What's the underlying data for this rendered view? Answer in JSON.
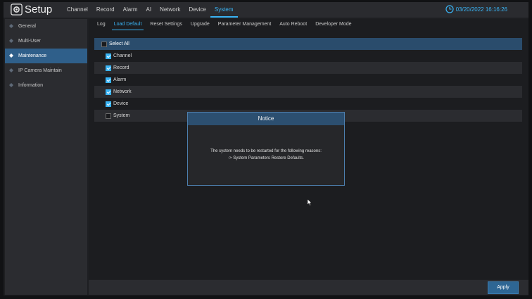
{
  "topbar": {
    "title": "Setup",
    "nav": [
      "Channel",
      "Record",
      "Alarm",
      "AI",
      "Network",
      "Device",
      "System"
    ],
    "active_nav": "System",
    "datetime": "03/20/2022 16:16:26"
  },
  "sidebar": {
    "items": [
      {
        "label": "General"
      },
      {
        "label": "Multi-User"
      },
      {
        "label": "Maintenance",
        "active": true
      },
      {
        "label": "IP Camera Maintain"
      },
      {
        "label": "Information"
      }
    ]
  },
  "tabs": [
    "Log",
    "Load Default",
    "Reset Settings",
    "Upgrade",
    "Parameter Management",
    "Auto Reboot",
    "Developer Mode"
  ],
  "active_tab": "Load Default",
  "options": {
    "select_all": {
      "label": "Select All",
      "checked": false
    },
    "items": [
      {
        "label": "Channel",
        "checked": true
      },
      {
        "label": "Record",
        "checked": true
      },
      {
        "label": "Alarm",
        "checked": true
      },
      {
        "label": "Network",
        "checked": true
      },
      {
        "label": "Device",
        "checked": true
      },
      {
        "label": "System",
        "checked": false
      }
    ]
  },
  "footer": {
    "apply_label": "Apply"
  },
  "notice": {
    "title": "Notice",
    "line1": "The system needs to be restarted for the following reasons:",
    "line2": "-> System Parameters Restore Defaults."
  },
  "colors": {
    "accent": "#3ab4f5",
    "active_bg": "#2f5f8a",
    "header_row": "#2a4c6c"
  }
}
